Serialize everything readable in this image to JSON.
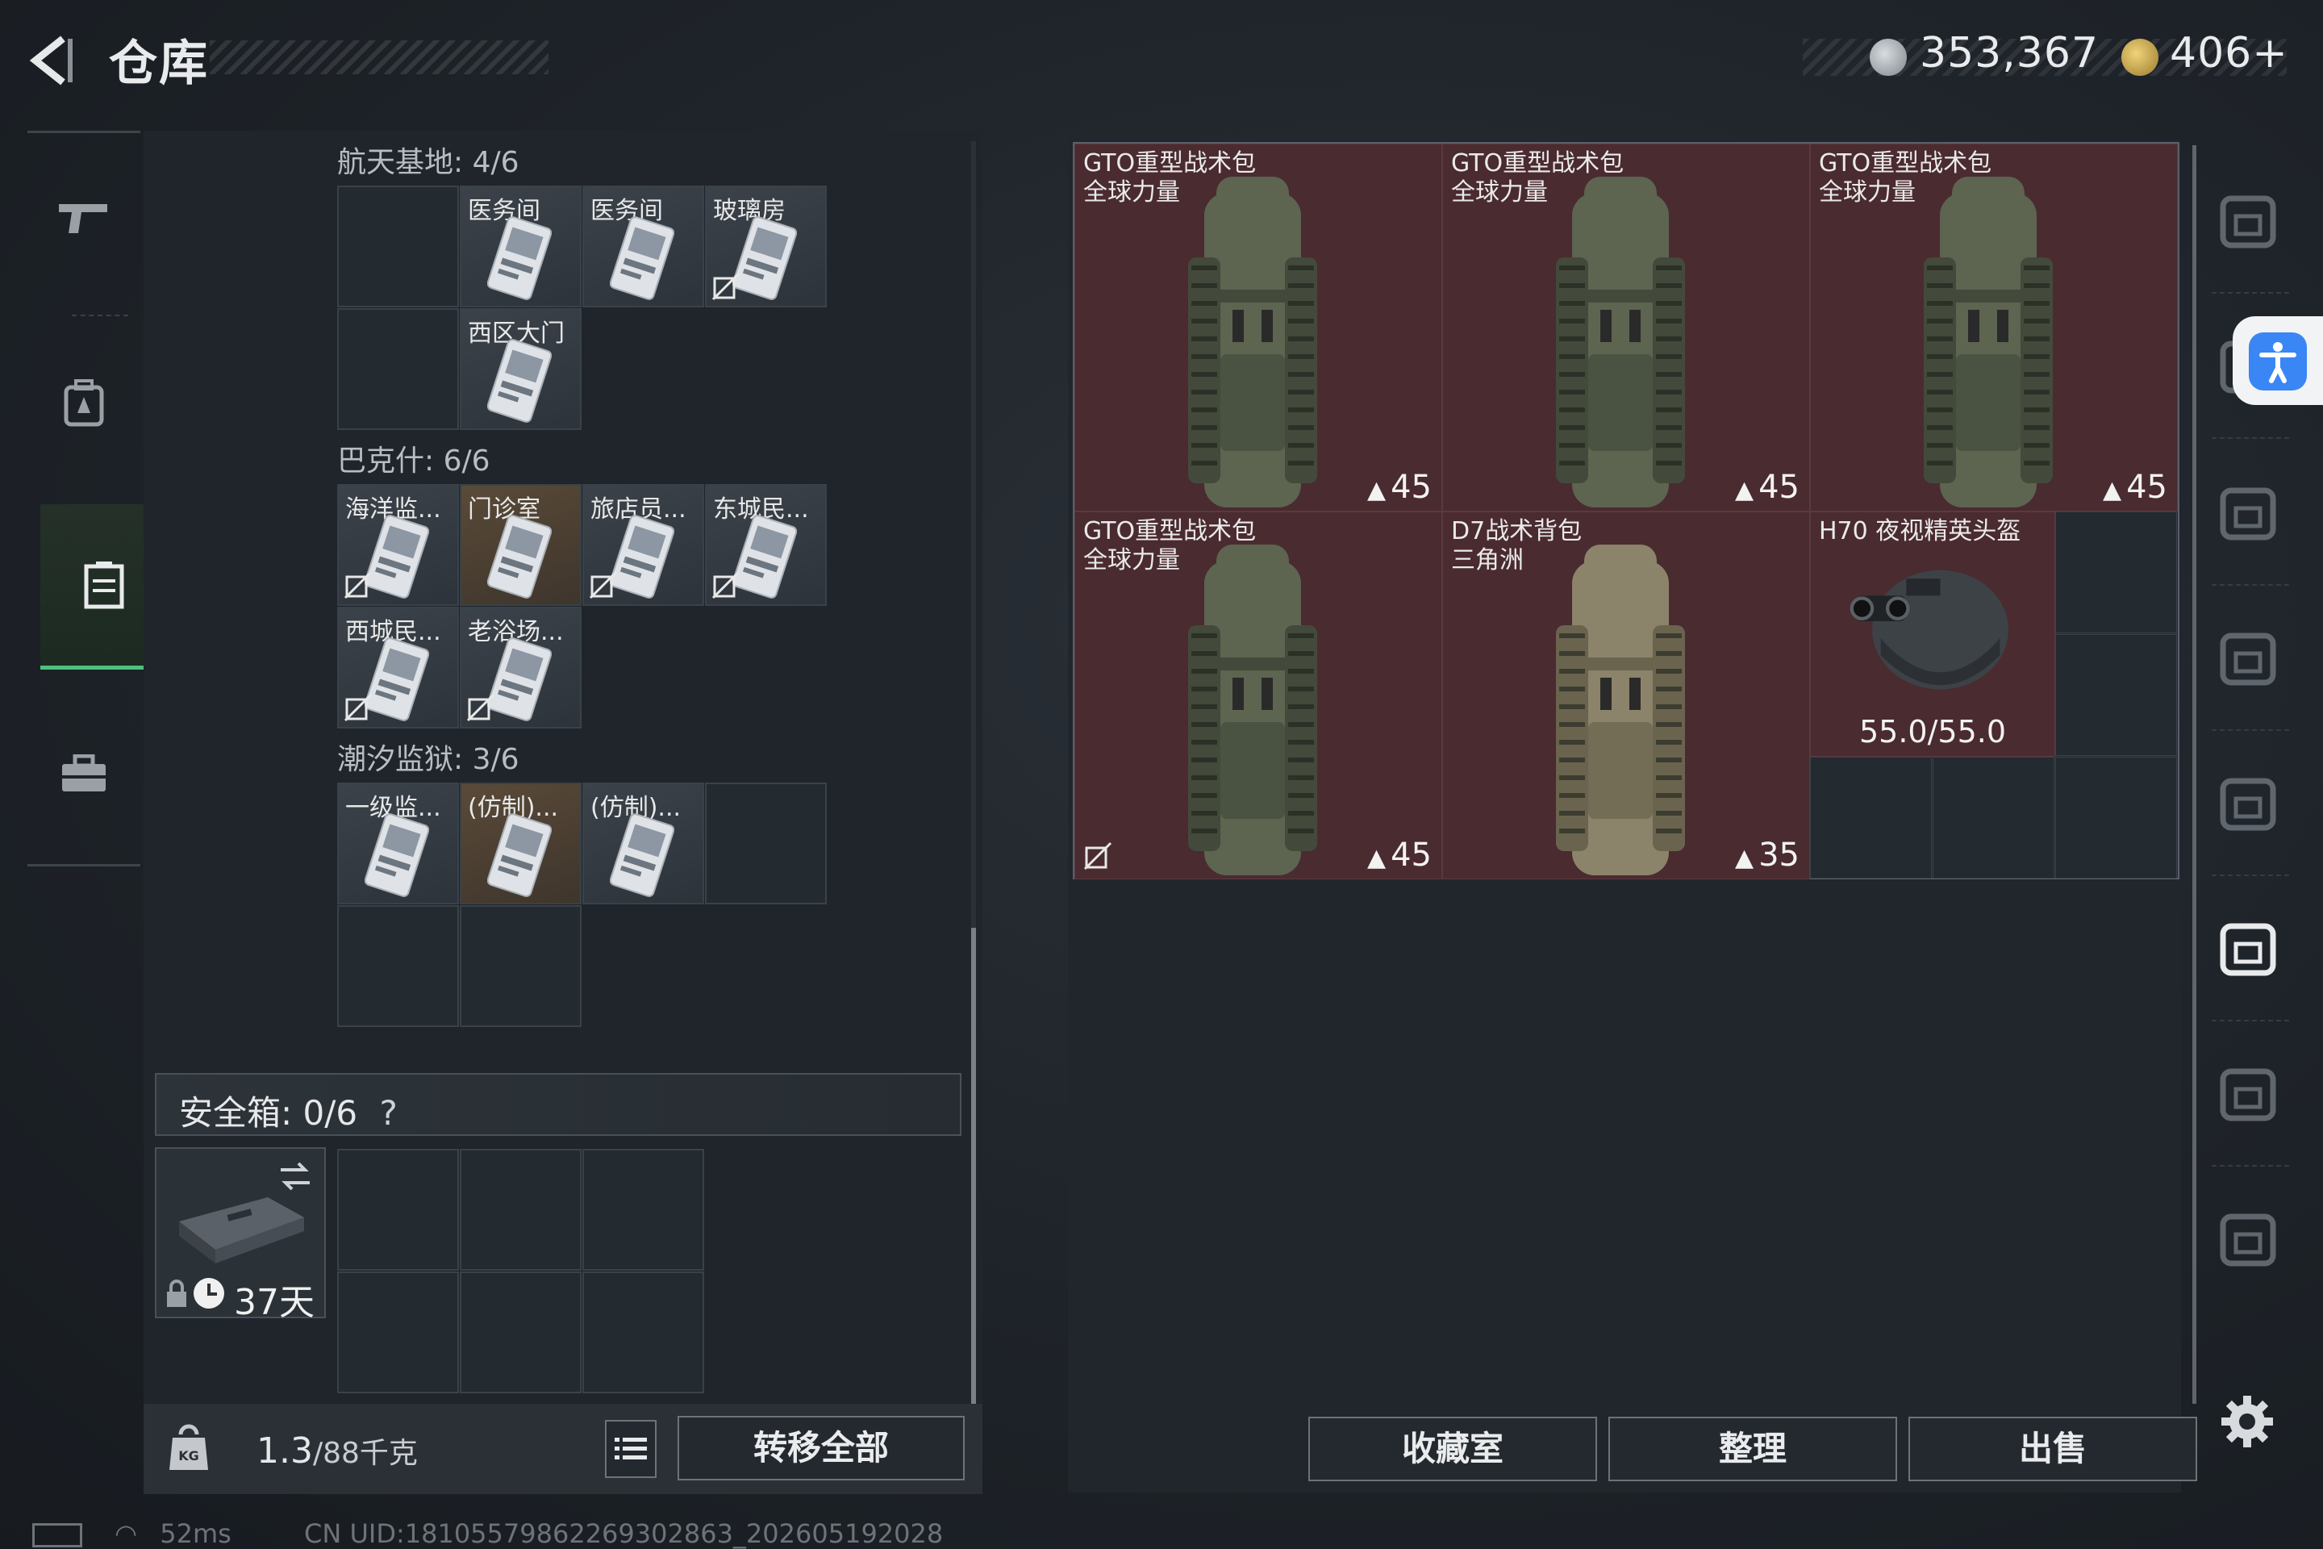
{
  "header": {
    "title": "仓库",
    "currency_silver": "353,367",
    "currency_gold": "406+"
  },
  "left_nav": {
    "items": [
      "weapon-icon",
      "backpack-icon",
      "container-icon",
      "toolbox-icon"
    ],
    "active_index": 2
  },
  "keycards": {
    "sections": [
      {
        "label": "航天基地: 4/6",
        "cells": [
          {
            "name": "",
            "empty": true
          },
          {
            "name": "医务间",
            "no_swap": false
          },
          {
            "name": "医务间",
            "no_swap": false
          },
          {
            "name": "玻璃房",
            "no_swap": true
          },
          {
            "name": "",
            "empty": true
          },
          {
            "name": "西区大门",
            "no_swap": false
          }
        ]
      },
      {
        "label": "巴克什: 6/6",
        "cells": [
          {
            "name": "海洋监...",
            "no_swap": true
          },
          {
            "name": "门诊室",
            "no_swap": false,
            "orange": true
          },
          {
            "name": "旅店员...",
            "no_swap": true
          },
          {
            "name": "东城民...",
            "no_swap": true
          },
          {
            "name": "西城民...",
            "no_swap": true
          },
          {
            "name": "老浴场...",
            "no_swap": true
          }
        ]
      },
      {
        "label": "潮汐监狱: 3/6",
        "cells": [
          {
            "name": "一级监...",
            "no_swap": false
          },
          {
            "name": "(仿制)...",
            "no_swap": false,
            "orange": true
          },
          {
            "name": "(仿制)...",
            "no_swap": false
          }
        ]
      }
    ]
  },
  "safe_box": {
    "label": "安全箱: 0/6",
    "help": "?",
    "days_left": "37天"
  },
  "bottom_left": {
    "weight": "1.3",
    "weight_max": "/88千克",
    "transfer_all": "转移全部"
  },
  "items": [
    {
      "name_line1": "GTO重型战术包",
      "name_line2": "全球力量",
      "capacity": "45",
      "no_swap": false
    },
    {
      "name_line1": "GTO重型战术包",
      "name_line2": "全球力量",
      "capacity": "45",
      "no_swap": false
    },
    {
      "name_line1": "GTO重型战术包",
      "name_line2": "全球力量",
      "capacity": "45",
      "no_swap": false
    },
    {
      "name_line1": "GTO重型战术包",
      "name_line2": "全球力量",
      "capacity": "45",
      "no_swap": true
    },
    {
      "name_line1": "D7战术背包",
      "name_line2": "三角洲",
      "capacity": "35",
      "no_swap": false
    },
    {
      "name_line1": "H70 夜视精英头盔",
      "name_line2": "",
      "durability": "55.0/55.0"
    }
  ],
  "bottom_right": {
    "collection": "收藏室",
    "organize": "整理",
    "sell": "出售"
  },
  "right_sidebar": {
    "items": [
      "helmet-icon",
      "armor-iv-icon",
      "armor-iii-icon",
      "rig-iv-icon",
      "rig-v-icon",
      "pouch-iii-icon",
      "case-iv-icon",
      "case-iii-icon"
    ]
  },
  "status": {
    "ping": "52ms",
    "uid": "CN UID:18105579862269302863_202605192028"
  }
}
